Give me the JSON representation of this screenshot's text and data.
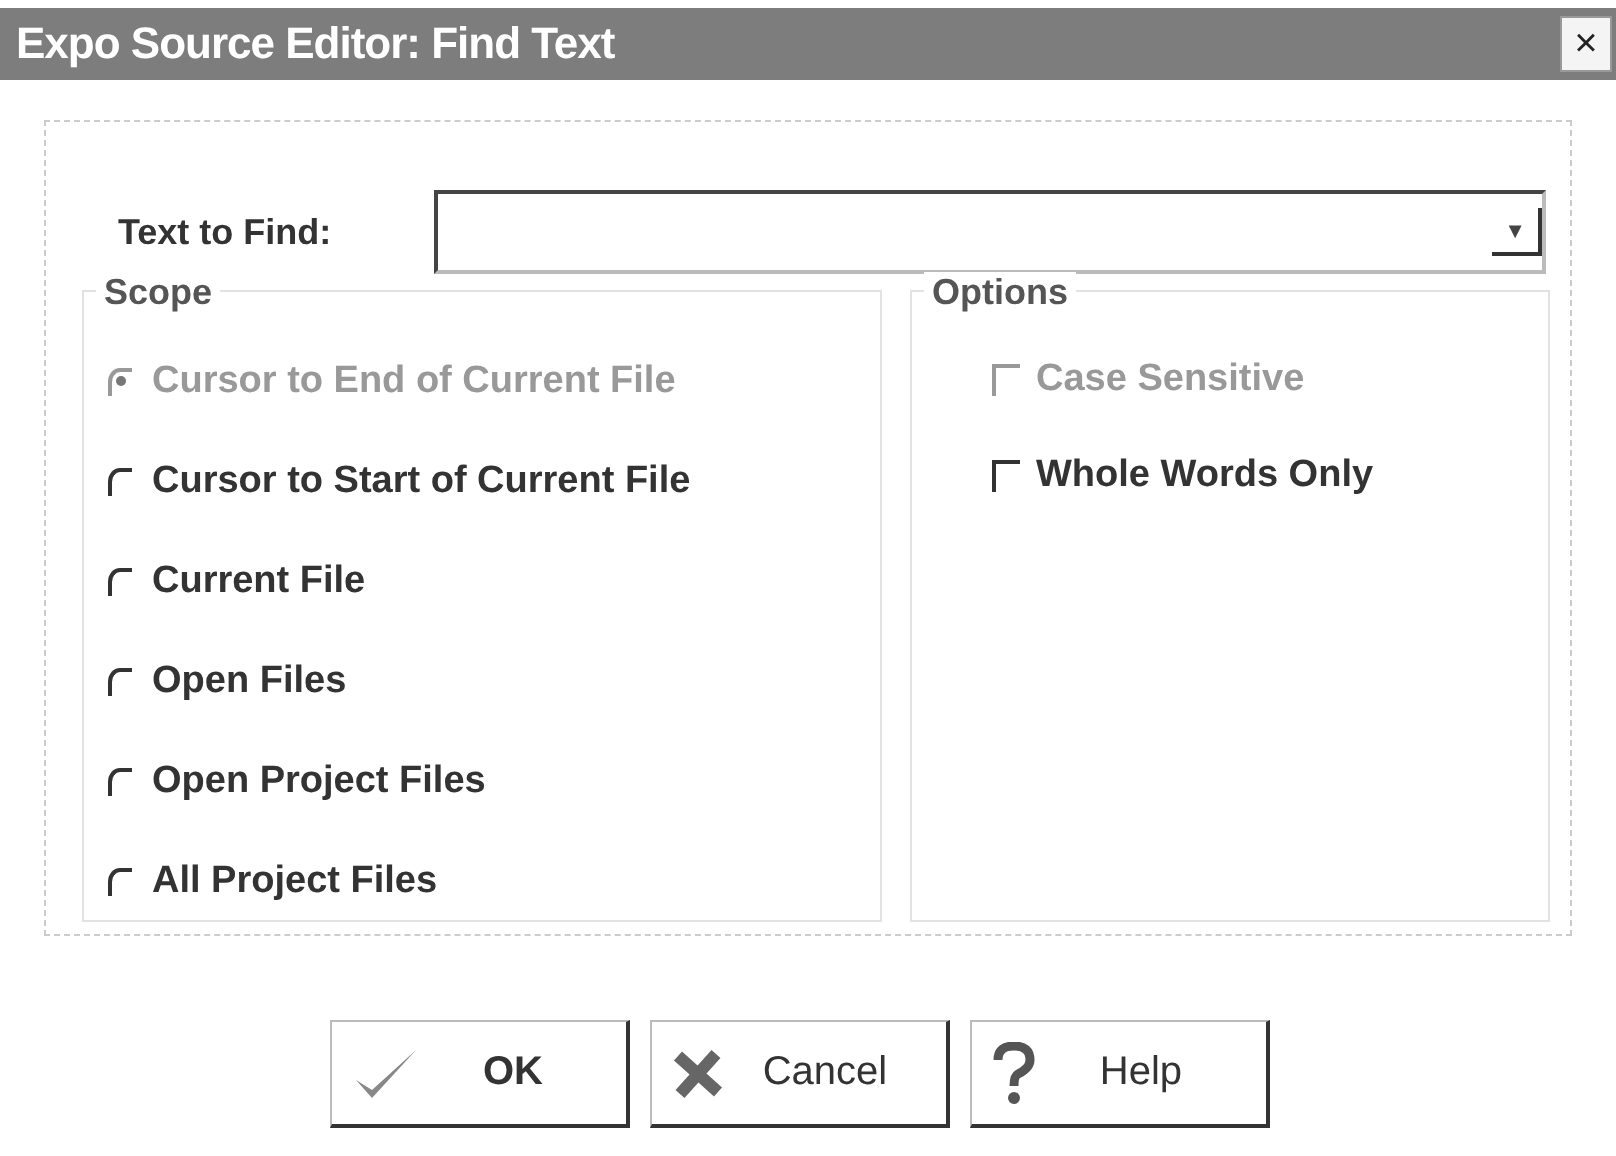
{
  "window": {
    "title": "Expo Source Editor: Find Text",
    "close": "×"
  },
  "find": {
    "label": "Text to Find:",
    "arrow": "▼"
  },
  "scope": {
    "title": "Scope",
    "items": [
      {
        "label": "Cursor to End of Current File",
        "selected": true,
        "disabled": true
      },
      {
        "label": "Cursor to Start of Current File",
        "selected": false,
        "disabled": false
      },
      {
        "label": "Current File",
        "selected": false,
        "disabled": false
      },
      {
        "label": "Open Files",
        "selected": false,
        "disabled": false
      },
      {
        "label": "Open Project Files",
        "selected": false,
        "disabled": false
      },
      {
        "label": "All Project Files",
        "selected": false,
        "disabled": false
      }
    ]
  },
  "options": {
    "title": "Options",
    "items": [
      {
        "label": "Case Sensitive",
        "checked": false,
        "disabled": true
      },
      {
        "label": "Whole Words Only",
        "checked": false,
        "disabled": false
      }
    ]
  },
  "buttons": [
    {
      "kind": "ok",
      "label": "OK"
    },
    {
      "kind": "cancel",
      "label": "Cancel"
    },
    {
      "kind": "help",
      "label": "Help"
    }
  ]
}
